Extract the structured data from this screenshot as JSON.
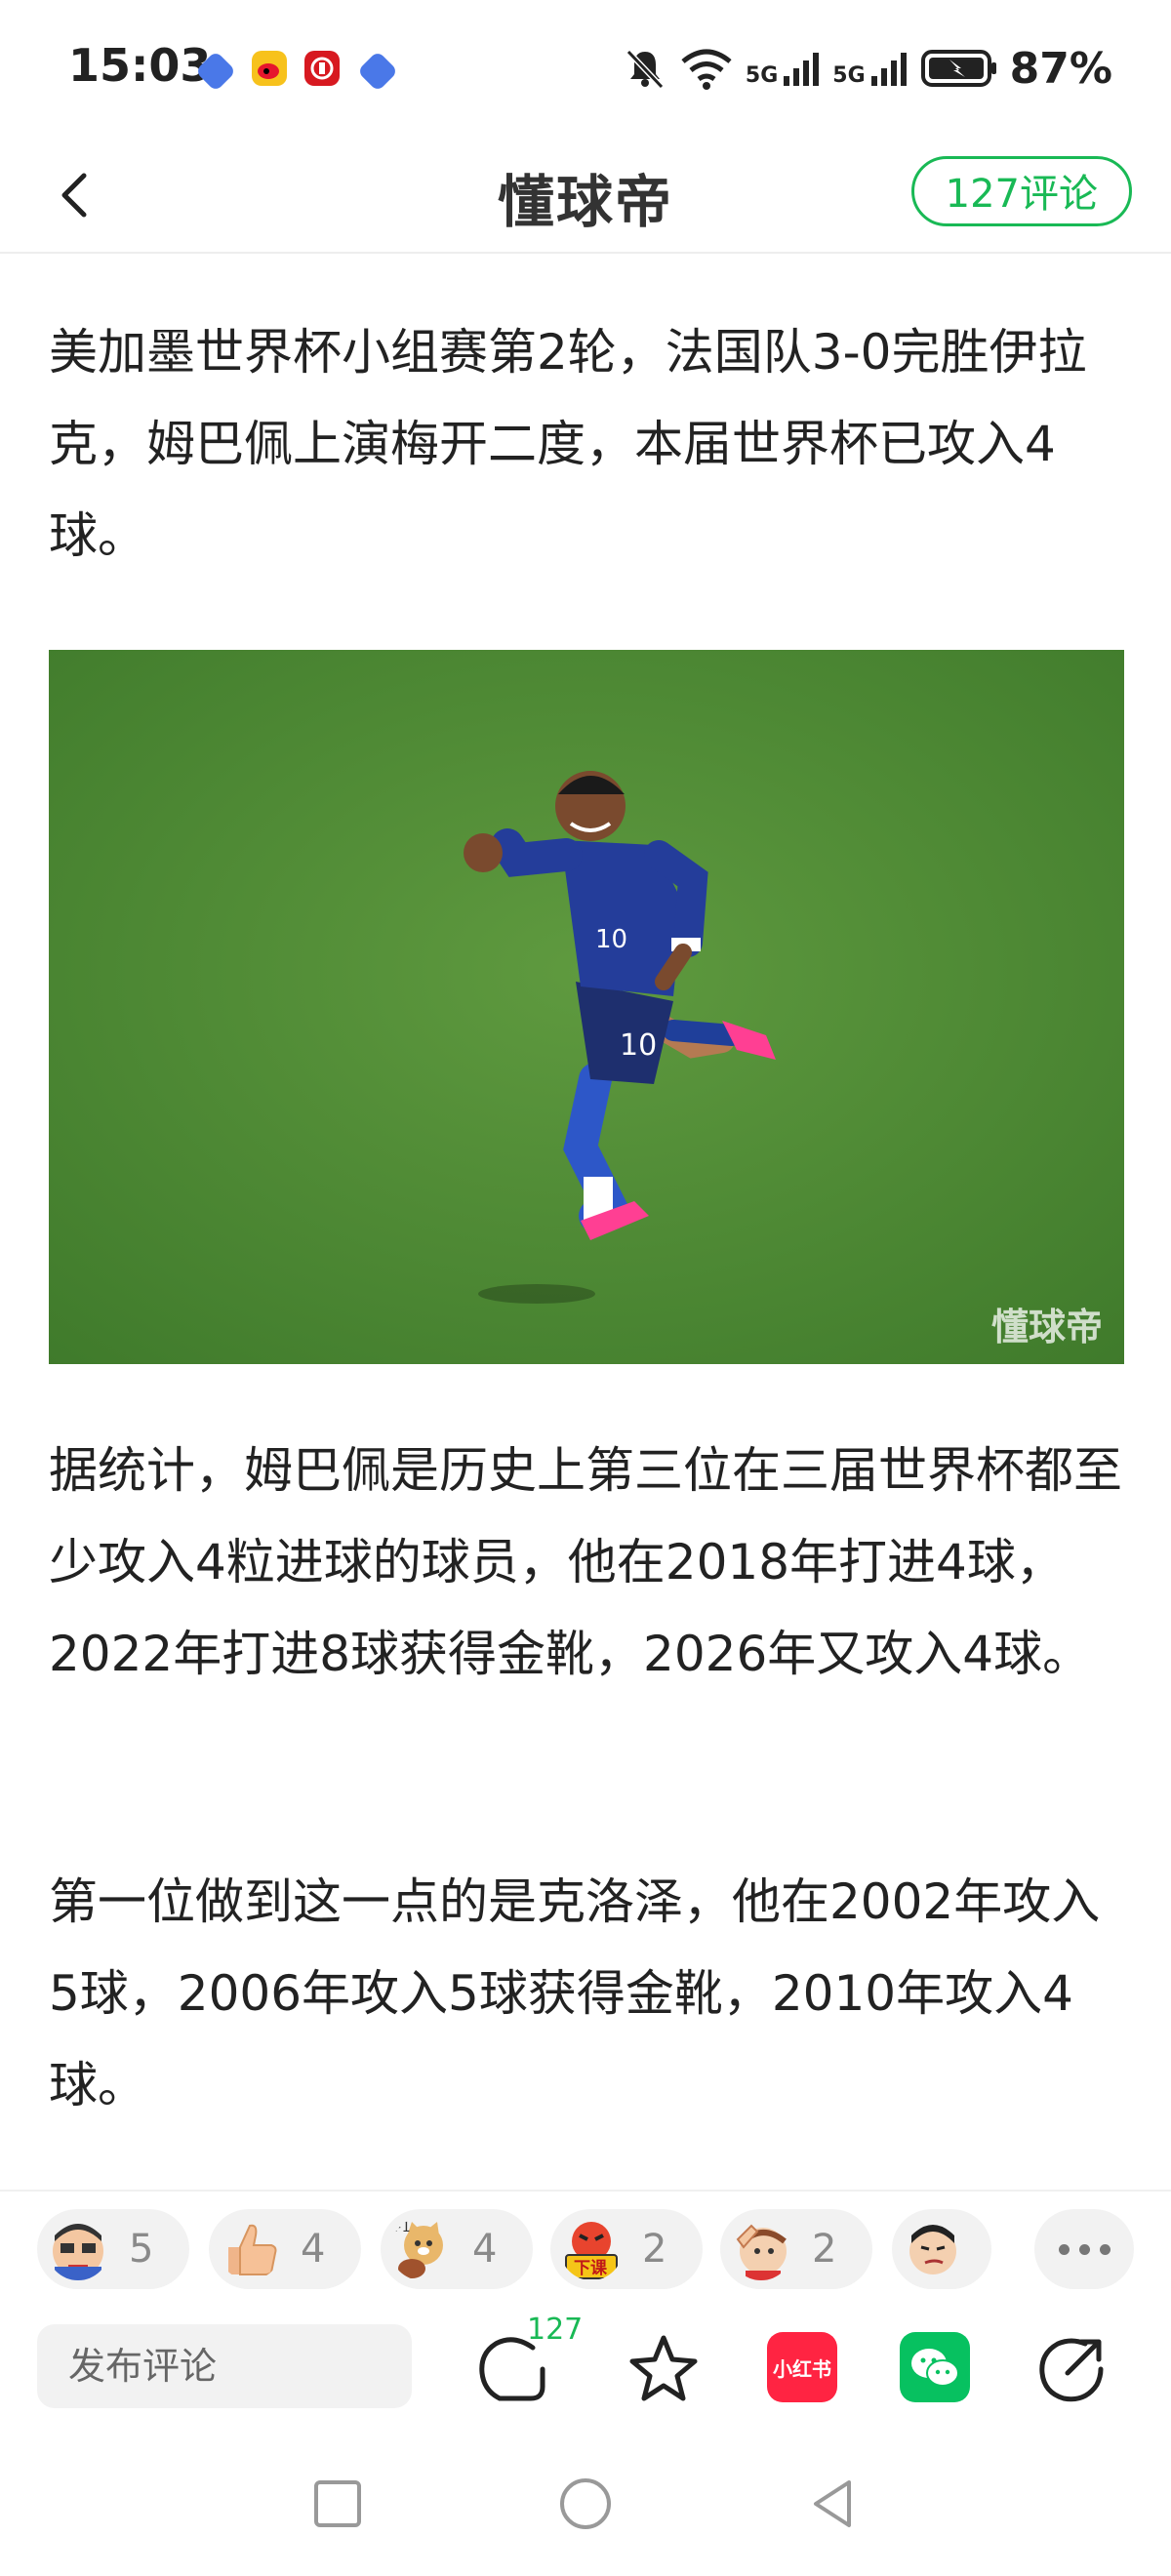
{
  "status_bar": {
    "time": "15:03",
    "battery": "87%",
    "network_labels": [
      "5G",
      "5G"
    ]
  },
  "header": {
    "brand": "懂球帝",
    "comments_button": "127评论"
  },
  "article": {
    "paragraphs": [
      "美加墨世界杯小组赛第2轮，法国队3-0完胜伊拉克，姆巴佩上演梅开二度，本届世界杯已攻入4球。",
      "据统计，姆巴佩是历史上第三位在三届世界杯都至少攻入4粒进球的球员，他在2018年打进4球，2022年打进8球获得金靴，2026年又攻入4球。",
      "第一位做到这一点的是克洛泽，他在2002年攻入5球，2006年攻入5球获得金靴，2010年攻入4球。"
    ],
    "image_watermark": "懂球帝",
    "jersey_number": "10"
  },
  "reactions": [
    {
      "icon": "angry-face-icon",
      "count": "5"
    },
    {
      "icon": "thumbs-up-icon",
      "count": "4"
    },
    {
      "icon": "doge-icon",
      "count": "4"
    },
    {
      "icon": "class-dismissed-icon",
      "count": "2"
    },
    {
      "icon": "facepalm-icon",
      "count": "2"
    },
    {
      "icon": "sneer-face-icon",
      "count": ""
    }
  ],
  "action_bar": {
    "comment_placeholder": "发布评论",
    "comment_count": "127",
    "xiaohongshu_label": "小红书"
  },
  "colors": {
    "accent_green": "#19b955",
    "xiaohongshu_red": "#ff2442",
    "wechat_green": "#07c160"
  }
}
